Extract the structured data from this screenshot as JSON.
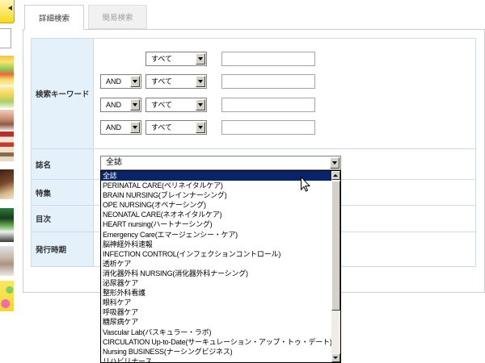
{
  "tabs": [
    {
      "label": "詳細検索",
      "active": true
    },
    {
      "label": "簡易検索",
      "active": false
    }
  ],
  "form": {
    "keyword": {
      "label": "検索キーワード",
      "rows": [
        {
          "field": "すべて",
          "value": ""
        },
        {
          "operator": "AND",
          "field": "すべて",
          "value": ""
        },
        {
          "operator": "AND",
          "field": "すべて",
          "value": ""
        },
        {
          "operator": "AND",
          "field": "すべて",
          "value": ""
        }
      ]
    },
    "magazine": {
      "label": "誌名",
      "selected": "全誌",
      "dropdown_open": true,
      "highlighted_index": 0,
      "options": [
        "全誌",
        "PERINATAL CARE(ペリネイタルケア)",
        "BRAIN NURSING(ブレインナーシング)",
        "OPE NURSING(オペナーシング)",
        "NEONATAL CARE(ネオネイタルケア)",
        "HEART nursing(ハートナーシング)",
        "Emergency Care(エマージェンシー・ケア)",
        "脳神経外科速報",
        "INFECTION CONTROL(インフェクションコントロール)",
        "透析ケア",
        "消化器外科 NURSING(消化器外科ナーシング)",
        "泌尿器ケア",
        "整形外科看護",
        "眼科ケア",
        "呼吸器ケア",
        "糖尿病ケア",
        "Vascular Lab(バスキュラー・ラボ)",
        "CIRCULATION Up-to-Date(サーキュレーション・アップ・トゥ・デート)",
        "Nursing BUSINESS(ナーシングビジネス)",
        "リハビリナース"
      ]
    },
    "feature": {
      "label": "特集"
    },
    "toc": {
      "label": "目次"
    },
    "period": {
      "label": "発行時期"
    }
  },
  "icons": {
    "select_arrow": "chevron-down-icon",
    "scroll_up": "scroll-up-arrow-icon",
    "scroll_down": "scroll-down-arrow-icon",
    "cursor": "mouse-cursor-icon",
    "sidebar_button": "arrow-icon"
  },
  "colors": {
    "label_bg": "#e4f1fb",
    "grid_line": "#cddbe6",
    "panel_border": "#cfcfcf",
    "highlight_bg": "#0a246a",
    "highlight_text": "#ffffff",
    "sidebar_button": "#f6d820"
  }
}
